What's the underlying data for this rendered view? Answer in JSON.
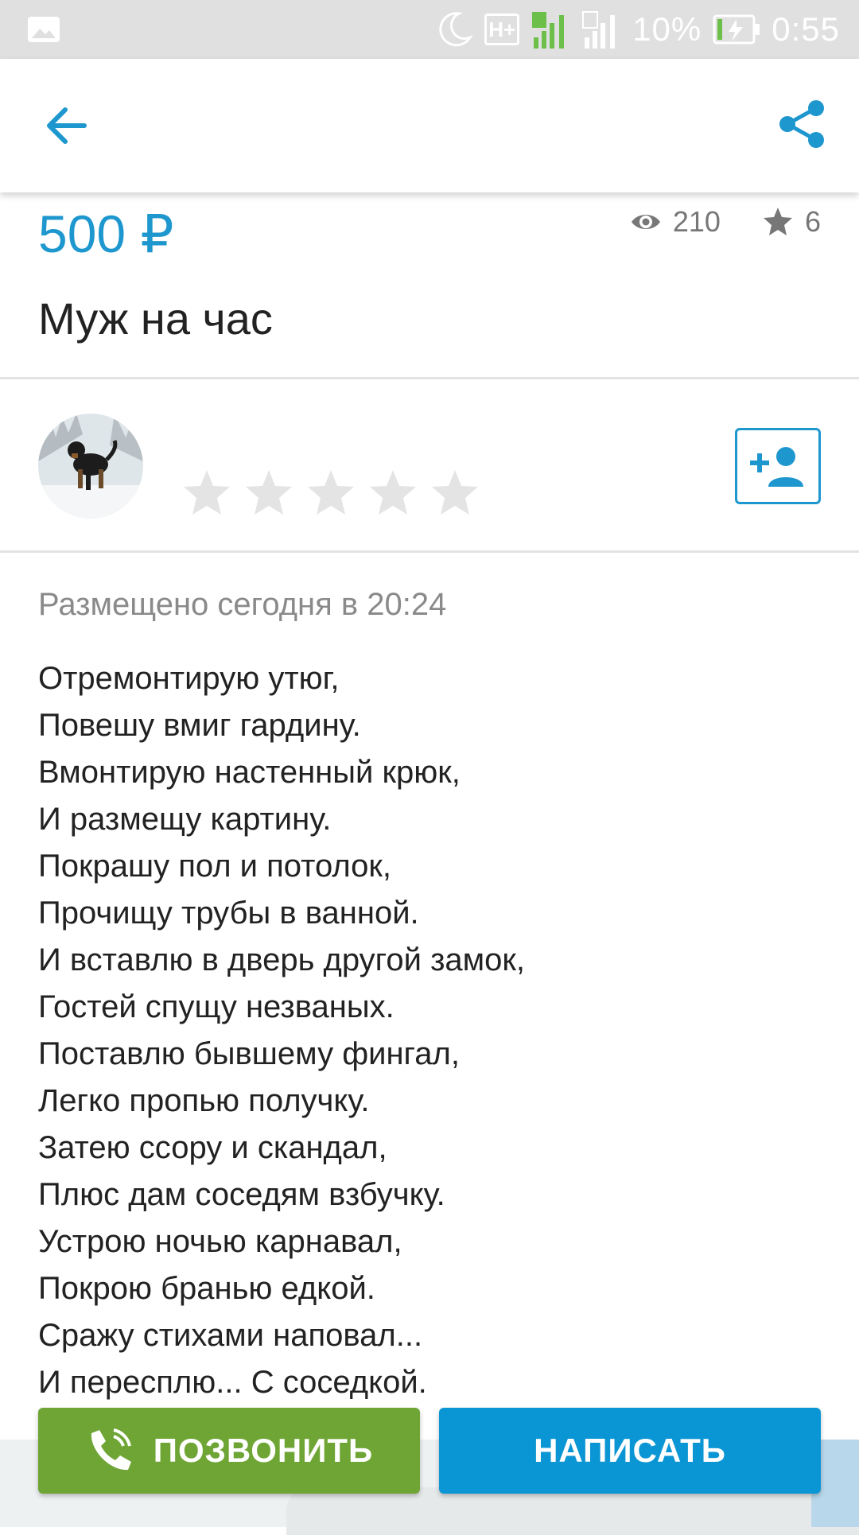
{
  "status_bar": {
    "network_badge": "H+",
    "sim1": "1",
    "sim2": "2",
    "battery_percent": "10%",
    "time": "0:55"
  },
  "toolbar": {
    "back_icon": "arrow-left-icon",
    "share_icon": "share-icon"
  },
  "listing": {
    "price": "500 ₽",
    "views": "210",
    "favorites": "6",
    "title": "Муж на час"
  },
  "seller": {
    "rating_stars_filled": 0,
    "rating_stars_total": 5,
    "follow_icon": "add-person-icon"
  },
  "posted": "Размещено сегодня в 20:24",
  "description_lines": [
    "Отремонтирую утюг,",
    "Повешу вмиг гардину.",
    "Вмонтирую настенный крюк,",
    "И размещу картину.",
    "Покрашу пол и потолок,",
    "Прочищу трубы в ванной.",
    "И вставлю в дверь другой замок,",
    "Гостей спущу незваных.",
    "Поставлю бывшему фингал,",
    "Легко пропью получку.",
    "Затею ссору и скандал,",
    "Плюс дам соседям взбучку.",
    "Устрою ночью карнавал,",
    "Покрою бранью едкой.",
    "Сражу стихами наповал...",
    "И пересплю... С соседкой."
  ],
  "actions": {
    "call_label": "ПОЗВОНИТЬ",
    "write_label": "НАПИСАТЬ"
  },
  "colors": {
    "accent": "#1e97cf",
    "call_green": "#6ea535",
    "write_blue": "#0a96d4"
  }
}
